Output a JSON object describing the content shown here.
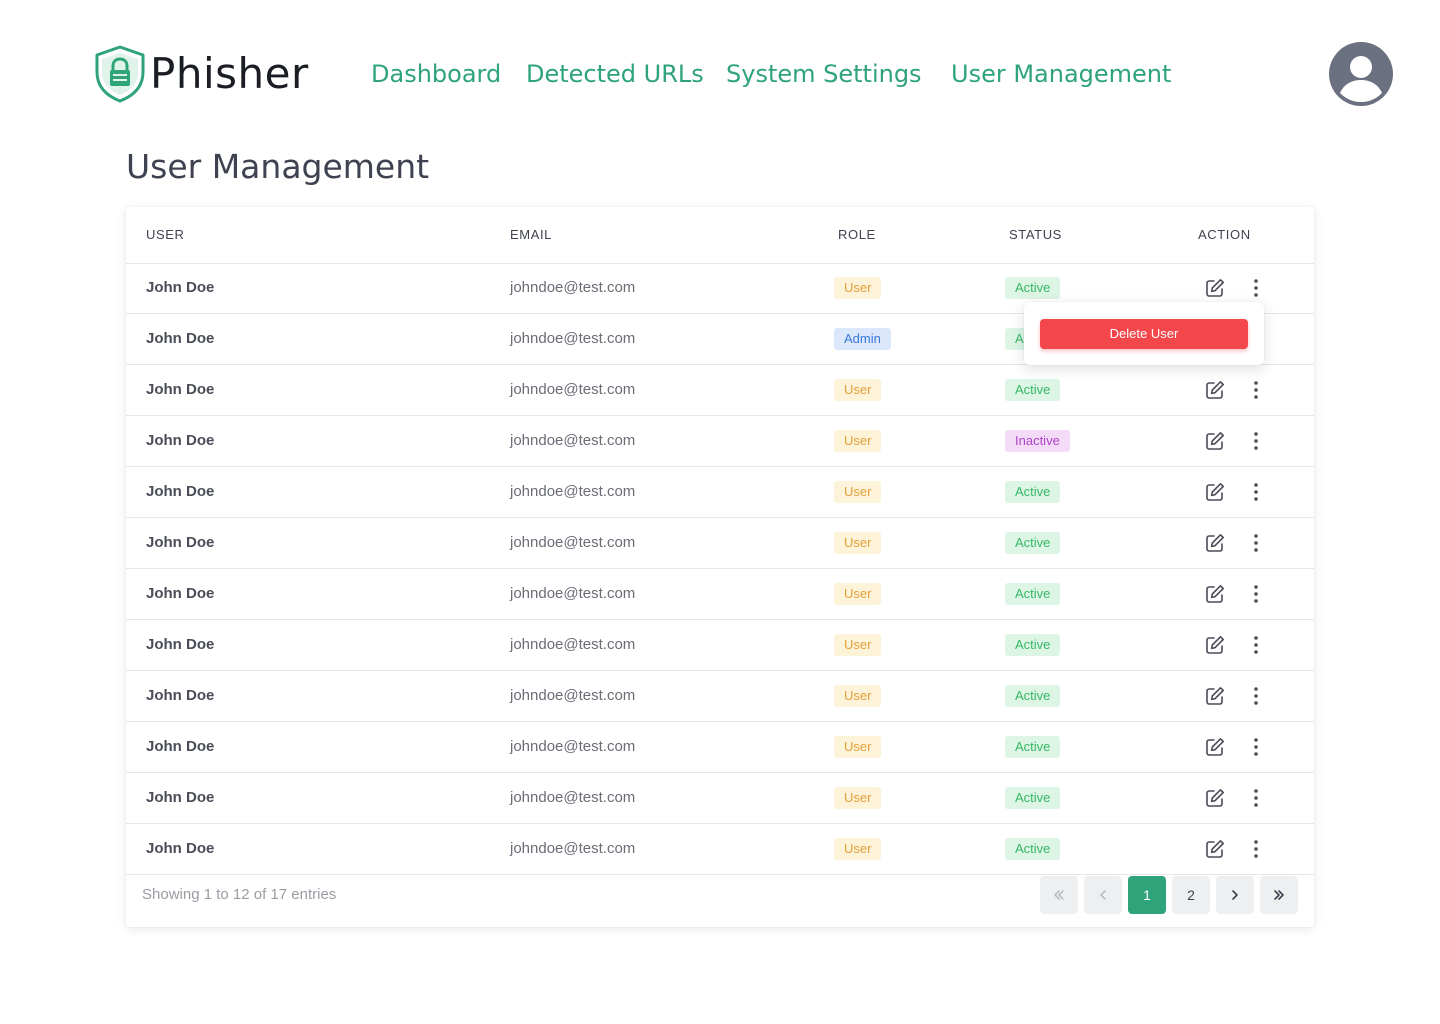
{
  "brand": {
    "name": "Phisher",
    "accent": "#2fa37a"
  },
  "nav": [
    {
      "label": "Dashboard"
    },
    {
      "label": "Detected URLs"
    },
    {
      "label": "System Settings"
    },
    {
      "label": "User Management"
    }
  ],
  "page": {
    "title": "User Management"
  },
  "table": {
    "headers": {
      "user": "USER",
      "email": "EMAIL",
      "role": "ROLE",
      "status": "STATUS",
      "action": "ACTION"
    },
    "rows": [
      {
        "name": "John Doe",
        "email": "johndoe@test.com",
        "role": "User",
        "status": "Active"
      },
      {
        "name": "John Doe",
        "email": "johndoe@test.com",
        "role": "Admin",
        "status": "Active"
      },
      {
        "name": "John Doe",
        "email": "johndoe@test.com",
        "role": "User",
        "status": "Active"
      },
      {
        "name": "John Doe",
        "email": "johndoe@test.com",
        "role": "User",
        "status": "Inactive"
      },
      {
        "name": "John Doe",
        "email": "johndoe@test.com",
        "role": "User",
        "status": "Active"
      },
      {
        "name": "John Doe",
        "email": "johndoe@test.com",
        "role": "User",
        "status": "Active"
      },
      {
        "name": "John Doe",
        "email": "johndoe@test.com",
        "role": "User",
        "status": "Active"
      },
      {
        "name": "John Doe",
        "email": "johndoe@test.com",
        "role": "User",
        "status": "Active"
      },
      {
        "name": "John Doe",
        "email": "johndoe@test.com",
        "role": "User",
        "status": "Active"
      },
      {
        "name": "John Doe",
        "email": "johndoe@test.com",
        "role": "User",
        "status": "Active"
      },
      {
        "name": "John Doe",
        "email": "johndoe@test.com",
        "role": "User",
        "status": "Active"
      },
      {
        "name": "John Doe",
        "email": "johndoe@test.com",
        "role": "User",
        "status": "Active"
      }
    ],
    "icons": {
      "edit": "edit-icon",
      "more": "more-vertical-icon"
    }
  },
  "row_menu": {
    "delete_label": "Delete User",
    "danger_color": "#f4474b"
  },
  "pagination": {
    "summary": "Showing 1 to 12 of 17 entries",
    "pages": [
      "1",
      "2"
    ],
    "current": "1",
    "icons": {
      "first": "double-chevron-left-icon",
      "prev": "chevron-left-icon",
      "next": "chevron-right-icon",
      "last": "double-chevron-right-icon"
    }
  }
}
